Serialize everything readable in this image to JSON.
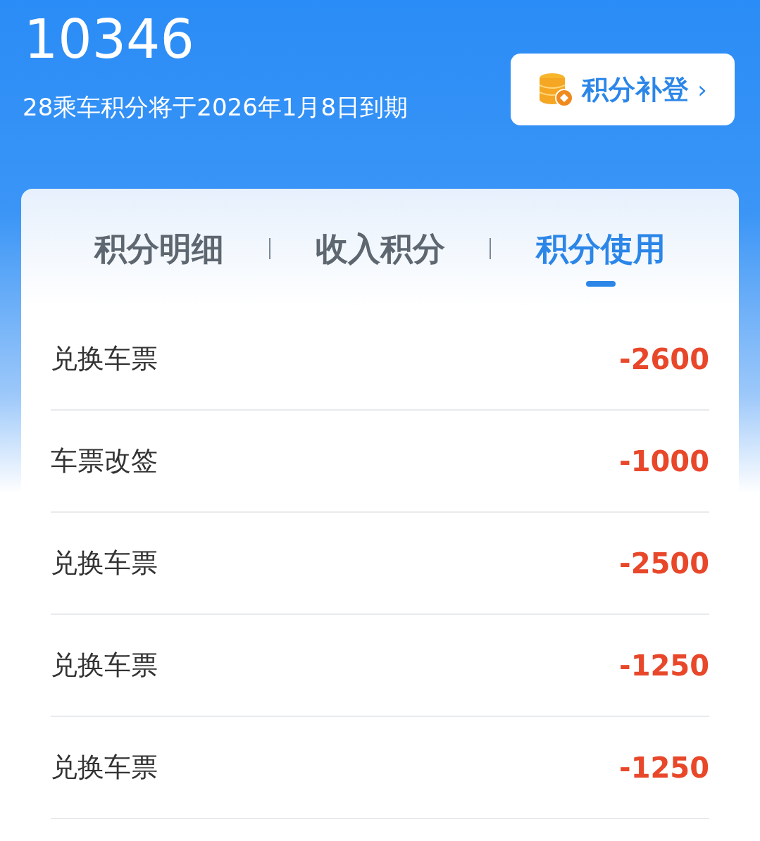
{
  "points": "10346",
  "expiry_notice": "28乘车积分将于2026年1月8日到期",
  "supplement_button": {
    "label": "积分补登",
    "chevron": "›"
  },
  "tabs": [
    {
      "label": "积分明细",
      "selected": false
    },
    {
      "label": "收入积分",
      "selected": false
    },
    {
      "label": "积分使用",
      "selected": true
    }
  ],
  "records": [
    {
      "title": "兑换车票",
      "amount": "-2600"
    },
    {
      "title": "车票改签",
      "amount": "-1000"
    },
    {
      "title": "兑换车票",
      "amount": "-2500"
    },
    {
      "title": "兑换车票",
      "amount": "-1250"
    },
    {
      "title": "兑换车票",
      "amount": "-1250"
    }
  ]
}
